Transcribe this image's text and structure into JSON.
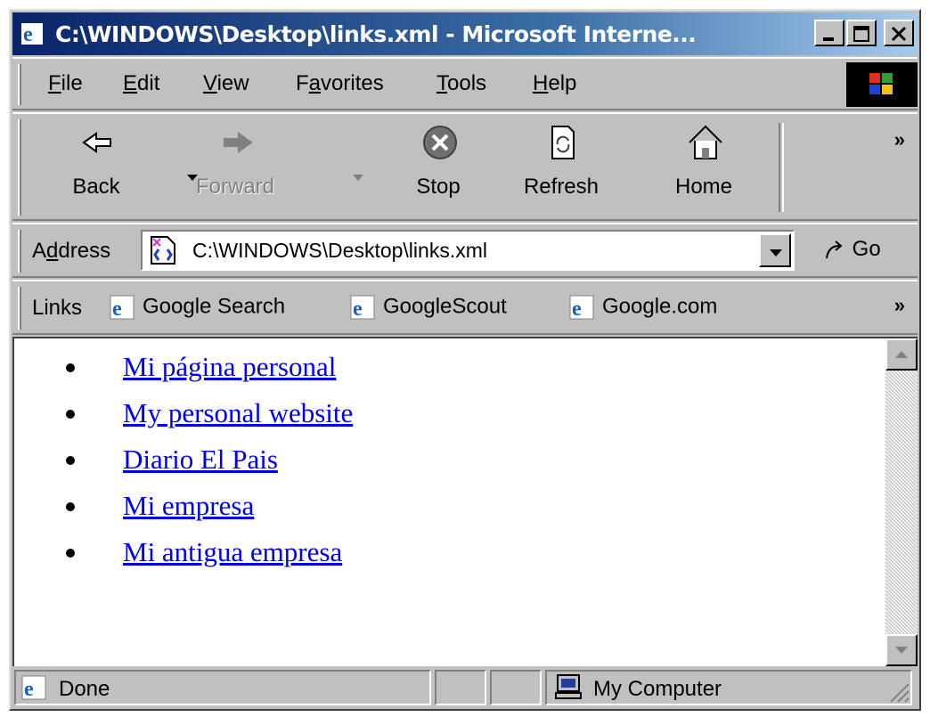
{
  "window": {
    "title": "C:\\WINDOWS\\Desktop\\links.xml - Microsoft Interne..."
  },
  "menu": {
    "items": [
      {
        "label": "File",
        "accel": "F",
        "rest": "ile"
      },
      {
        "label": "Edit",
        "accel": "E",
        "rest": "dit"
      },
      {
        "label": "View",
        "accel": "V",
        "rest": "iew"
      },
      {
        "label": "Favorites",
        "pre": "F",
        "accel": "a",
        "rest": "vorites"
      },
      {
        "label": "Tools",
        "accel": "T",
        "rest": "ools"
      },
      {
        "label": "Help",
        "accel": "H",
        "rest": "elp"
      }
    ]
  },
  "toolbar": {
    "back": "Back",
    "forward": "Forward",
    "stop": "Stop",
    "refresh": "Refresh",
    "home": "Home"
  },
  "address": {
    "label_pre": "A",
    "label_accel": "d",
    "label_rest": "dress",
    "value": "C:\\WINDOWS\\Desktop\\links.xml",
    "go": "Go"
  },
  "links_bar": {
    "label": "Links",
    "items": [
      "Google Search",
      "GoogleScout",
      "Google.com"
    ]
  },
  "page": {
    "links": [
      "Mi página personal",
      "My personal website",
      "Diario El Pais",
      "Mi empresa",
      "Mi antigua empresa"
    ]
  },
  "status": {
    "text": "Done",
    "zone": "My Computer"
  },
  "colors": {
    "link": "#0000ee",
    "titlebar_start": "#0a246a",
    "chrome": "#c0c0c0"
  }
}
